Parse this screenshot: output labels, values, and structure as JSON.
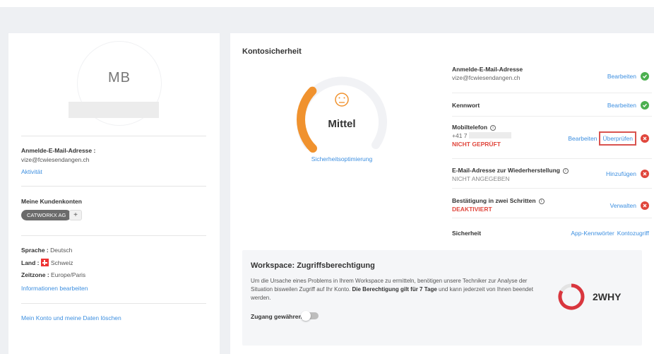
{
  "profile": {
    "initials": "MB",
    "login_email_label": "Anmelde-E-Mail-Adresse :",
    "login_email_value": "vize@fcwiesendangen.ch",
    "activity_link": "Aktivität",
    "customer_accounts_title": "Meine Kundenkonten",
    "customer_account_chip": "CATWORKX AG",
    "add_button": "+",
    "language_label": "Sprache :",
    "language_value": "Deutsch",
    "country_label": "Land :",
    "country_value": "Schweiz",
    "timezone_label": "Zeitzone :",
    "timezone_value": "Europe/Paris",
    "edit_info_link": "Informationen bearbeiten",
    "delete_link": "Mein Konto und meine Daten löschen"
  },
  "security": {
    "title": "Kontosicherheit",
    "level": "Mittel",
    "level_fraction": 0.33,
    "optimize_link": "Sicherheitsoptimierung",
    "rows": {
      "email": {
        "title": "Anmelde-E-Mail-Adresse",
        "value": "vize@fcwiesendangen.ch",
        "action": "Bearbeiten",
        "status": "ok"
      },
      "password": {
        "title": "Kennwort",
        "action": "Bearbeiten",
        "status": "ok"
      },
      "phone": {
        "title": "Mobiltelefon",
        "value": "+41 7",
        "state": "NICHT GEPRÜFT",
        "action": "Bearbeiten",
        "action2": "Überprüfen",
        "status": "error"
      },
      "recovery": {
        "title": "E-Mail-Adresse zur Wiederherstellung",
        "state": "NICHT ANGEGEBEN",
        "action": "Hinzufügen",
        "status": "error"
      },
      "twofa": {
        "title": "Bestätigung in zwei Schritten",
        "state": "DEAKTIVIERT",
        "action": "Verwalten",
        "status": "error"
      },
      "safety": {
        "title": "Sicherheit",
        "action": "App-Kennwörter",
        "action2": "Kontozugriff"
      }
    }
  },
  "workspace": {
    "title": "Workspace: Zugriffsberechtigung",
    "body_part1": "Um die Ursache eines Problems in Ihrem Workspace zu ermitteln, benötigen unsere Techniker zur Analyse der Situation bisweilen Zugriff auf Ihr Konto. ",
    "body_bold": "Die Berechtigung gilt für 7 Tage",
    "body_part2": " und kann jederzeit von Ihnen beendet werden.",
    "access_label": "Zugang gewähren",
    "access_enabled": false,
    "brand": "2WHY"
  },
  "colors": {
    "link": "#3d8fe0",
    "ok": "#4caf50",
    "error": "#e0463c",
    "gauge": "#f0922e",
    "ring": "#d9363e"
  }
}
